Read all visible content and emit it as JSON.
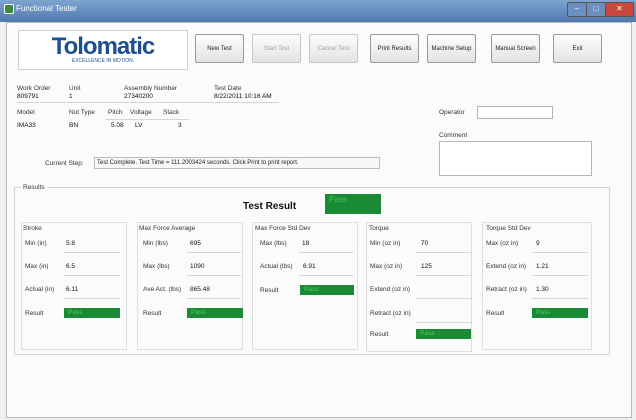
{
  "window": {
    "title": "Functional Tester",
    "min_icon": "minimize-icon",
    "max_icon": "maximize-icon",
    "close_icon": "close-icon",
    "close_glyph": "✕"
  },
  "logo": {
    "brand": "Tolomatic",
    "tagline": "EXCELLENCE IN MOTION."
  },
  "toolbar": {
    "new_test": "New Test",
    "start_test": "Start Test",
    "cancel_test": "Cancel Test",
    "print_results": "Print Results",
    "machine_setup": "Machine Setup",
    "manual_screen": "Manual Screen",
    "exit": "Exit"
  },
  "info": {
    "work_order_label": "Work Order",
    "work_order": "809791",
    "unit_label": "Unit",
    "unit": "1",
    "assembly_label": "Assembly Number",
    "assembly": "27340200",
    "test_date_label": "Test Date",
    "test_date": "8/22/2011 10:16 AM",
    "model_label": "Model",
    "model": "IMA33",
    "nut_label": "Nut Type",
    "nut": "BN",
    "pitch_label": "Pitch",
    "pitch": "5.08",
    "voltage_label": "Voltage",
    "voltage": "LV",
    "stack_label": "Stack",
    "stack": "3",
    "operator_label": "Operator",
    "comment_label": "Comment",
    "current_step_label": "Current Step:",
    "current_step": "Test Complete. Test Time = 111.2003424 seconds. Click Print to print report."
  },
  "results": {
    "section_label": "Results",
    "title": "Test Result",
    "status": "Pass",
    "stroke": {
      "title": "Stroke",
      "min_label": "Min (in)",
      "min": "5.8",
      "max_label": "Max (in)",
      "max": "6.5",
      "actual_label": "Actual (in)",
      "actual": "6.11",
      "result_label": "Result",
      "result": "Pass"
    },
    "max_force_avg": {
      "title": "Max Force Average",
      "min_label": "Min (lbs)",
      "min": "695",
      "max_label": "Max (lbs)",
      "max": "1090",
      "ave_label": "Ave Act. (lbs)",
      "ave": "865.48",
      "result_label": "Result",
      "result": "Pass"
    },
    "max_force_std": {
      "title": "Max Force Std Dev",
      "max_label": "Max (lbs)",
      "max": "18",
      "actual_label": "Actual (lbs)",
      "actual": "6.91",
      "result_label": "Result",
      "result": "Pass"
    },
    "torque": {
      "title": "Torque",
      "min_label": "Min (oz in)",
      "min": "70",
      "max_label": "Max (oz in)",
      "max": "125",
      "extend_label": "Extend (oz in)",
      "retract_label": "Retract (oz in)",
      "result_label": "Result",
      "result": "Pass"
    },
    "torque_std": {
      "title": "Torque Std Dev",
      "max_label": "Max (oz in)",
      "max": "9",
      "extend_label": "Extend (oz in)",
      "extend": "1.21",
      "retract_label": "Retract (oz in)",
      "retract": "1.30",
      "result_label": "Result",
      "result": "Pass"
    }
  },
  "colors": {
    "pass_bg": "#1a8a35",
    "pass_text": "#4fcf58",
    "titlebar": "#5b84b8",
    "brand": "#1d4f91"
  }
}
